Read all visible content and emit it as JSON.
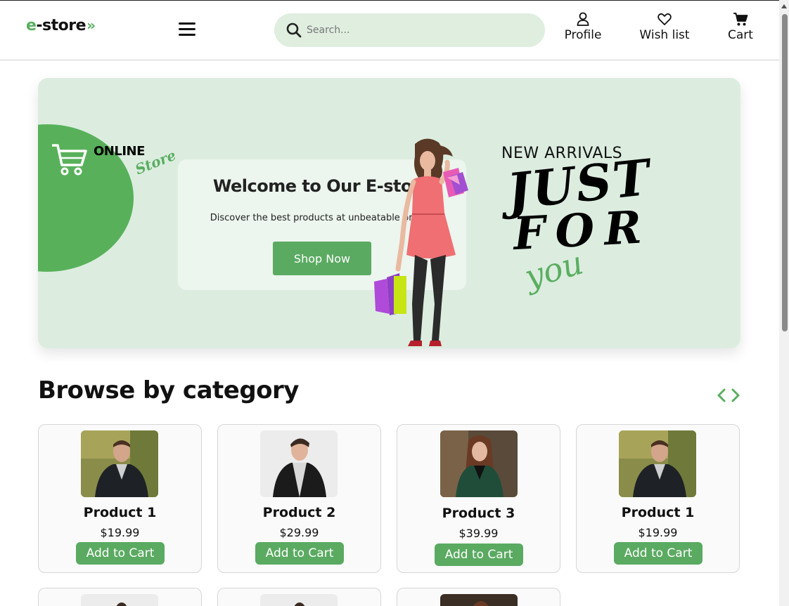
{
  "header": {
    "logo_prefix": "e",
    "logo_rest": "-store",
    "logo_chevron": "»",
    "search_placeholder": "Search...",
    "nav": [
      {
        "label": "Profile",
        "icon": "user-icon"
      },
      {
        "label": "Wish list",
        "icon": "heart-icon"
      },
      {
        "label": "Cart",
        "icon": "cart-icon"
      }
    ]
  },
  "hero": {
    "brand_online": "ONLINE",
    "brand_store": "Store",
    "title": "Welcome to Our E-store",
    "subtitle": "Discover the best products at unbeatable prices!",
    "cta": "Shop Now",
    "new_arrivals": "NEW ARRIVALS",
    "just": "JUST",
    "for": "FOR",
    "you": "you"
  },
  "category": {
    "title": "Browse by category",
    "products": [
      {
        "name": "Product 1",
        "price": "$19.99",
        "button": "Add to Cart"
      },
      {
        "name": "Product 2",
        "price": "$29.99",
        "button": "Add to Cart"
      },
      {
        "name": "Product 3",
        "price": "$39.99",
        "button": "Add to Cart"
      },
      {
        "name": "Product 1",
        "price": "$19.99",
        "button": "Add to Cart"
      }
    ]
  },
  "colors": {
    "accent": "#5aae60",
    "hero_bg": "#dcede0",
    "search_bg": "#dfeedf"
  }
}
